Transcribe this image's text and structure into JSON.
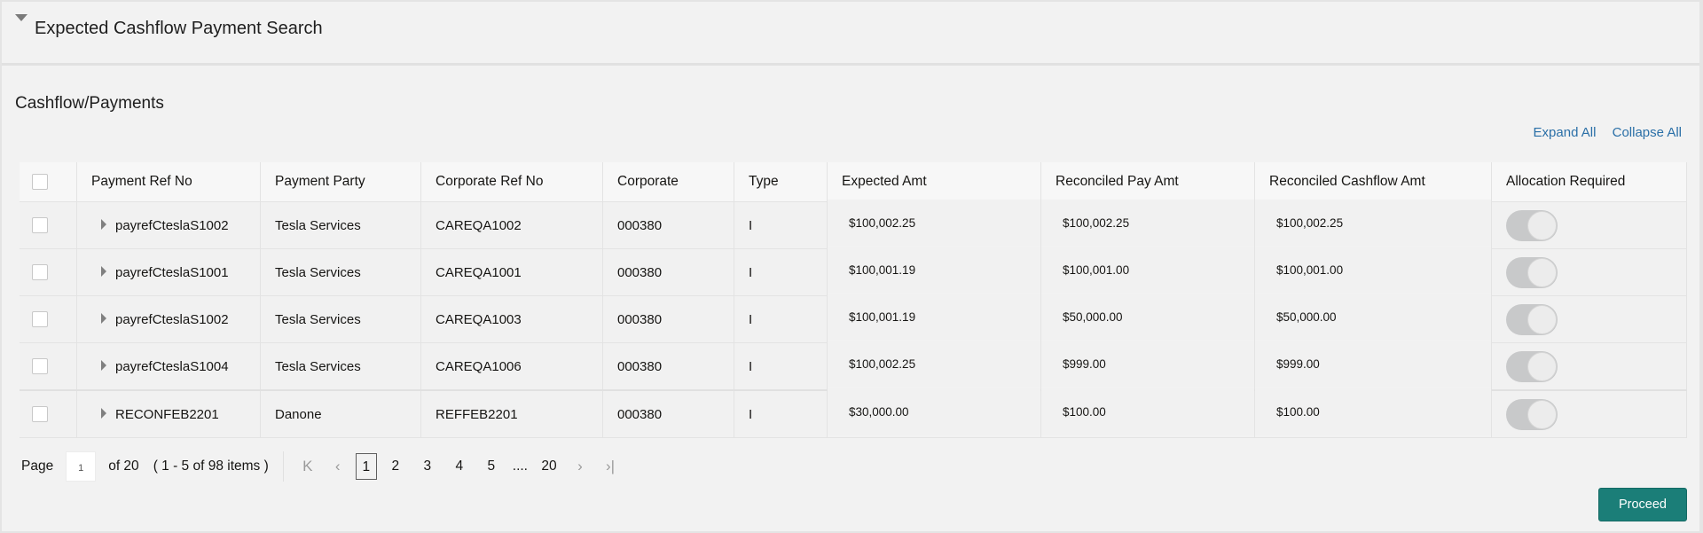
{
  "search_panel": {
    "title": "Expected Cashflow Payment Search",
    "collapse_icon": "caret-down-icon"
  },
  "section": {
    "title": "Cashflow/Payments",
    "expand_all": "Expand All",
    "collapse_all": "Collapse All"
  },
  "table": {
    "columns": [
      "Payment Ref No",
      "Payment Party",
      "Corporate Ref No",
      "Corporate",
      "Type",
      "Expected Amt",
      "Reconciled Pay Amt",
      "Reconciled Cashflow Amt",
      "Allocation Required"
    ],
    "rows": [
      {
        "payment_ref_no": "payrefCteslaS1002",
        "payment_party": "Tesla Services",
        "corporate_ref_no": "CAREQA1002",
        "corporate": "000380",
        "type": "I",
        "expected_amt": "$100,002.25",
        "reconciled_pay_amt": "$100,002.25",
        "reconciled_cashflow_amt": "$100,002.25",
        "allocation_required": true,
        "selected": false
      },
      {
        "payment_ref_no": "payrefCteslaS1001",
        "payment_party": "Tesla Services",
        "corporate_ref_no": "CAREQA1001",
        "corporate": "000380",
        "type": "I",
        "expected_amt": "$100,001.19",
        "reconciled_pay_amt": "$100,001.00",
        "reconciled_cashflow_amt": "$100,001.00",
        "allocation_required": true,
        "selected": false
      },
      {
        "payment_ref_no": "payrefCteslaS1002",
        "payment_party": "Tesla Services",
        "corporate_ref_no": "CAREQA1003",
        "corporate": "000380",
        "type": "I",
        "expected_amt": "$100,001.19",
        "reconciled_pay_amt": "$50,000.00",
        "reconciled_cashflow_amt": "$50,000.00",
        "allocation_required": true,
        "selected": false
      },
      {
        "payment_ref_no": "payrefCteslaS1004",
        "payment_party": "Tesla Services",
        "corporate_ref_no": "CAREQA1006",
        "corporate": "000380",
        "type": "I",
        "expected_amt": "$100,002.25",
        "reconciled_pay_amt": "$999.00",
        "reconciled_cashflow_amt": "$999.00",
        "allocation_required": true,
        "selected": false
      },
      {
        "payment_ref_no": "RECONFEB2201",
        "payment_party": "Danone",
        "corporate_ref_no": "REFFEB2201",
        "corporate": "000380",
        "type": "I",
        "expected_amt": "$30,000.00",
        "reconciled_pay_amt": "$100.00",
        "reconciled_cashflow_amt": "$100.00",
        "allocation_required": true,
        "selected": false
      }
    ]
  },
  "pagination": {
    "page_label": "Page",
    "current_page": "1",
    "of_label": "of 20",
    "range_label": "( 1 - 5 of 98 items )",
    "pages": [
      "1",
      "2",
      "3",
      "4",
      "5"
    ],
    "ellipsis": "....",
    "last_page": "20",
    "first_icon": "first-page-icon",
    "prev_icon": "prev-page-icon",
    "next_icon": "next-page-icon",
    "last_icon": "last-page-icon"
  },
  "actions": {
    "proceed_label": "Proceed"
  },
  "colors": {
    "primary_button": "#1b7e78",
    "link": "#2a6fa7",
    "type_text": "#1a237e",
    "toggle_disabled": "#c8c9ca"
  }
}
